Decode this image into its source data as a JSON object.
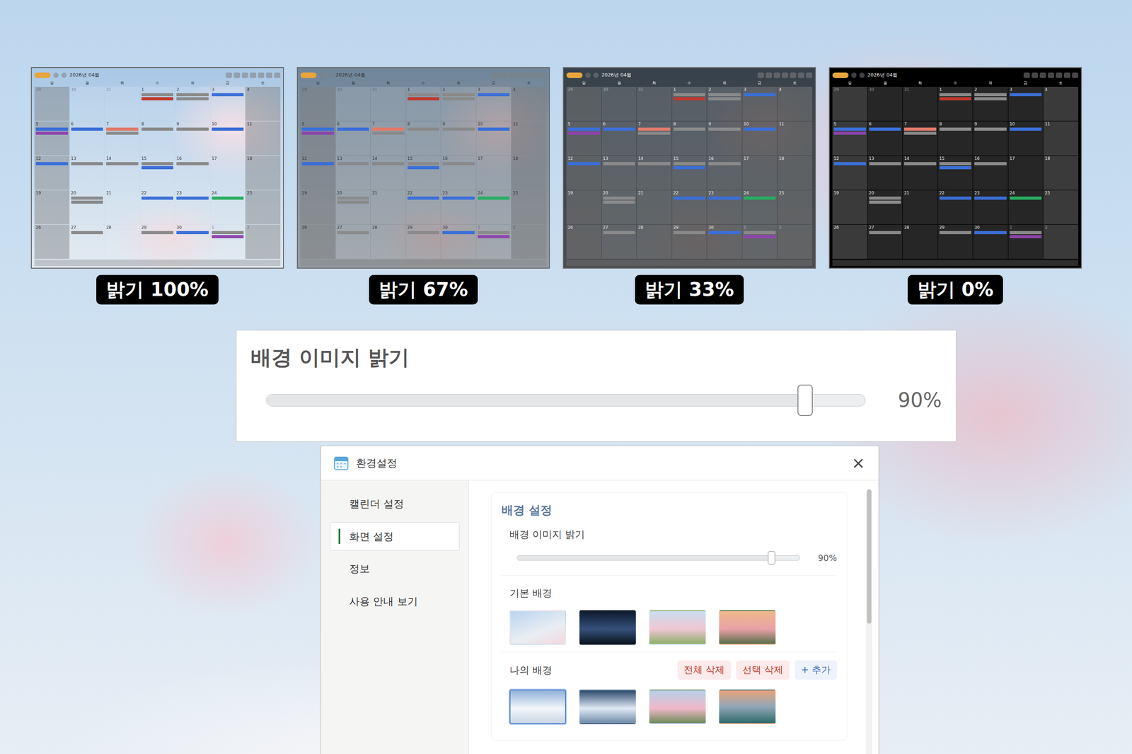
{
  "previews": [
    {
      "label": "밝기 100%",
      "level": 1
    },
    {
      "label": "밝기 67%",
      "level": 0.67
    },
    {
      "label": "밝기 33%",
      "level": 0.33
    },
    {
      "label": "밝기 0%",
      "level": 0
    }
  ],
  "calendar": {
    "title": "2026년 04월",
    "weekdays": [
      "일",
      "월",
      "화",
      "수",
      "목",
      "금",
      "토"
    ],
    "days": [
      {
        "n": "29",
        "muted": true
      },
      {
        "n": "30",
        "muted": true
      },
      {
        "n": "31",
        "muted": true
      },
      {
        "n": "1",
        "muted": false
      },
      {
        "n": "2",
        "muted": false
      },
      {
        "n": "3",
        "muted": false
      },
      {
        "n": "4",
        "muted": false
      },
      {
        "n": "5",
        "muted": false
      },
      {
        "n": "6",
        "muted": false
      },
      {
        "n": "7",
        "muted": false
      },
      {
        "n": "8",
        "muted": false
      },
      {
        "n": "9",
        "muted": false
      },
      {
        "n": "10",
        "muted": false
      },
      {
        "n": "11",
        "muted": false
      },
      {
        "n": "12",
        "muted": false
      },
      {
        "n": "13",
        "muted": false
      },
      {
        "n": "14",
        "muted": false
      },
      {
        "n": "15",
        "muted": false
      },
      {
        "n": "16",
        "muted": false
      },
      {
        "n": "17",
        "muted": false
      },
      {
        "n": "18",
        "muted": false
      },
      {
        "n": "19",
        "muted": false
      },
      {
        "n": "20",
        "muted": false
      },
      {
        "n": "21",
        "muted": false
      },
      {
        "n": "22",
        "muted": false
      },
      {
        "n": "23",
        "muted": false
      },
      {
        "n": "24",
        "muted": false
      },
      {
        "n": "25",
        "muted": false
      },
      {
        "n": "26",
        "muted": false
      },
      {
        "n": "27",
        "muted": false
      },
      {
        "n": "28",
        "muted": false
      },
      {
        "n": "29",
        "muted": false
      },
      {
        "n": "30",
        "muted": false
      },
      {
        "n": "1",
        "muted": true
      },
      {
        "n": "2",
        "muted": true
      }
    ],
    "events": [
      {
        "cell": 3,
        "color": "#8a8a8a"
      },
      {
        "cell": 3,
        "color": "#c0392b"
      },
      {
        "cell": 4,
        "color": "#8a8a8a"
      },
      {
        "cell": 4,
        "color": "#8a8a8a"
      },
      {
        "cell": 5,
        "color": "#3b6fd8"
      },
      {
        "cell": 7,
        "color": "#3b6fd8"
      },
      {
        "cell": 7,
        "color": "#8e44ad"
      },
      {
        "cell": 8,
        "color": "#3b6fd8"
      },
      {
        "cell": 9,
        "color": "#e07a6a"
      },
      {
        "cell": 9,
        "color": "#8a8a8a"
      },
      {
        "cell": 10,
        "color": "#8a8a8a"
      },
      {
        "cell": 11,
        "color": "#8a8a8a"
      },
      {
        "cell": 12,
        "color": "#3b6fd8"
      },
      {
        "cell": 14,
        "color": "#3b6fd8"
      },
      {
        "cell": 15,
        "color": "#8a8a8a"
      },
      {
        "cell": 16,
        "color": "#8a8a8a"
      },
      {
        "cell": 17,
        "color": "#8a8a8a"
      },
      {
        "cell": 17,
        "color": "#3b6fd8"
      },
      {
        "cell": 18,
        "color": "#8a8a8a"
      },
      {
        "cell": 22,
        "color": "#8a8a8a"
      },
      {
        "cell": 22,
        "color": "#8a8a8a"
      },
      {
        "cell": 24,
        "color": "#3b6fd8"
      },
      {
        "cell": 25,
        "color": "#3b6fd8"
      },
      {
        "cell": 26,
        "color": "#27ae60"
      },
      {
        "cell": 29,
        "color": "#8a8a8a"
      },
      {
        "cell": 31,
        "color": "#8a8a8a"
      },
      {
        "cell": 32,
        "color": "#3b6fd8"
      },
      {
        "cell": 33,
        "color": "#8a8a8a"
      },
      {
        "cell": 33,
        "color": "#8e44ad"
      }
    ]
  },
  "zoom": {
    "title": "배경 이미지 밝기",
    "level": 0.9,
    "reading": "90%"
  },
  "dialog": {
    "title": "환경설정",
    "close": "×",
    "sidebar": [
      {
        "label": "캘린더 설정",
        "selected": false
      },
      {
        "label": "화면 설정",
        "selected": true
      },
      {
        "label": "정보",
        "selected": false
      },
      {
        "label": "사용 안내 보기",
        "selected": false
      }
    ],
    "section": "배경 설정",
    "brightness": {
      "label": "배경 이미지 밝기",
      "level": 0.9,
      "reading": "90%"
    },
    "defaults": {
      "label": "기본 배경",
      "items": [
        {
          "selected": false
        },
        {
          "selected": false
        },
        {
          "selected": false
        },
        {
          "selected": false
        }
      ]
    },
    "mine": {
      "label": "나의 배경",
      "buttons": [
        {
          "label": "전체 삭제",
          "kind": "danger"
        },
        {
          "label": "선택 삭제",
          "kind": "danger"
        },
        {
          "label": "+ 추가",
          "kind": "add"
        }
      ],
      "items": [
        {
          "selected": true
        },
        {
          "selected": false
        },
        {
          "selected": false
        },
        {
          "selected": false
        }
      ]
    }
  }
}
